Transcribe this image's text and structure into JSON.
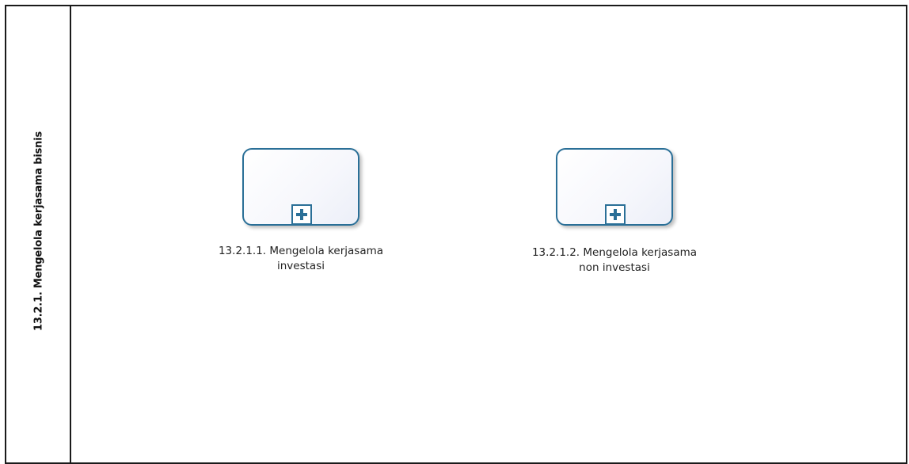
{
  "lane": {
    "title": "13.2.1. Mengelola kerjasama bisnis"
  },
  "tasks": [
    {
      "line1": "13.2.1.1. Mengelola kerjasama",
      "line2": "investasi"
    },
    {
      "line1": "13.2.1.2. Mengelola kerjasama",
      "line2": "non investasi"
    }
  ],
  "colors": {
    "task_border": "#2a6f97",
    "marker_plus": "#2a6f97",
    "pool_border": "#1a1a1a"
  },
  "icons": {
    "subprocess_marker": "plus-icon"
  }
}
